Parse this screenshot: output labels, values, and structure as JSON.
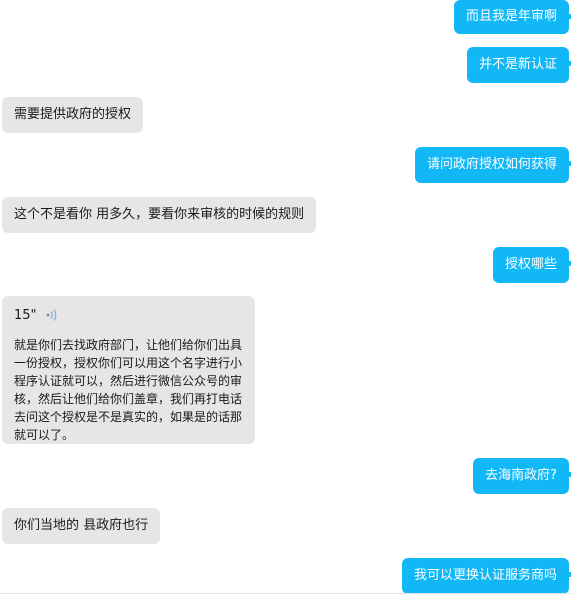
{
  "messages": {
    "m1": "而且我是年审啊",
    "m2": "并不是新认证",
    "m3": "需要提供政府的授权",
    "m4": "请问政府授权如何获得",
    "m5": "这个不是看你 用多久，要看你来审核的时候的规则",
    "m6": "授权哪些",
    "voice": {
      "duration": "15\"",
      "transcript": "就是你们去找政府部门，让他们给你们出具一份授权，授权你们可以用这个名字进行小程序认证就可以，然后进行微信公众号的审核，然后让他们给你们盖章，我们再打电话去问这个授权是不是真实的，如果是的话那就可以了。"
    },
    "m8": "去海南政府?",
    "m9": "你们当地的 县政府也行",
    "m10": "我可以更换认证服务商吗"
  },
  "colors": {
    "outgoing_bubble": "#12b7f5",
    "incoming_bubble": "#e6e6e6"
  },
  "icons": {
    "voice": "voice-wave-icon"
  }
}
